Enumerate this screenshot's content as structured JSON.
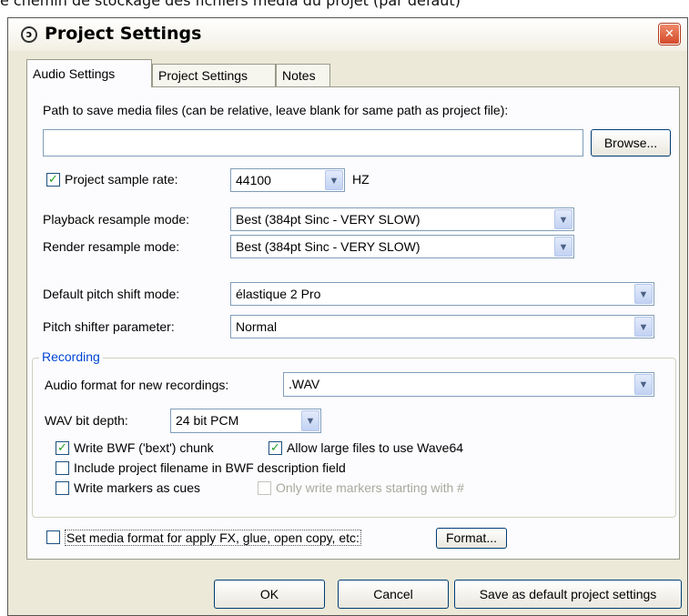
{
  "caption": "e chemin de stockage des fichiers média du projet (par défaut)",
  "window": {
    "title": "Project Settings"
  },
  "tabs": [
    {
      "label": "Audio Settings",
      "active": true
    },
    {
      "label": "Project Settings",
      "active": false
    },
    {
      "label": "Notes",
      "active": false
    }
  ],
  "media_path": {
    "label": "Path to save media files (can be relative, leave blank for same path as project file):",
    "value": "",
    "browse_label": "Browse..."
  },
  "sample_rate": {
    "checkbox_label": "Project sample rate:",
    "checked": true,
    "value": "44100",
    "unit": "HZ"
  },
  "playback_resample": {
    "label": "Playback resample mode:",
    "value": "Best (384pt Sinc - VERY SLOW)"
  },
  "render_resample": {
    "label": "Render resample mode:",
    "value": "Best (384pt Sinc - VERY SLOW)"
  },
  "pitch_shift": {
    "label": "Default pitch shift mode:",
    "value": "élastique 2 Pro"
  },
  "pitch_param": {
    "label": "Pitch shifter parameter:",
    "value": "Normal"
  },
  "recording": {
    "group_title": "Recording",
    "format_label": "Audio format for new recordings:",
    "format_value": ".WAV",
    "bitdepth_label": "WAV bit depth:",
    "bitdepth_value": "24 bit PCM",
    "write_bwf": {
      "label": "Write BWF ('bext') chunk",
      "checked": true
    },
    "allow_large": {
      "label": "Allow large files to use Wave64",
      "checked": true
    },
    "include_filename": {
      "label": "Include project filename in BWF description field",
      "checked": false
    },
    "write_markers": {
      "label": "Write markers as cues",
      "checked": false
    },
    "only_markers": {
      "label": "Only write markers starting with #",
      "checked": false
    }
  },
  "media_format": {
    "label": "Set media format for apply FX, glue, open copy, etc:",
    "checked": false,
    "button_label": "Format..."
  },
  "buttons": {
    "ok": "OK",
    "cancel": "Cancel",
    "save_default": "Save as default project settings"
  },
  "colors": {
    "group_title": "#0046d5",
    "check": "#21a121",
    "dialog_bg": "#ece9d8",
    "panel_bg": "#fcfcfe"
  }
}
